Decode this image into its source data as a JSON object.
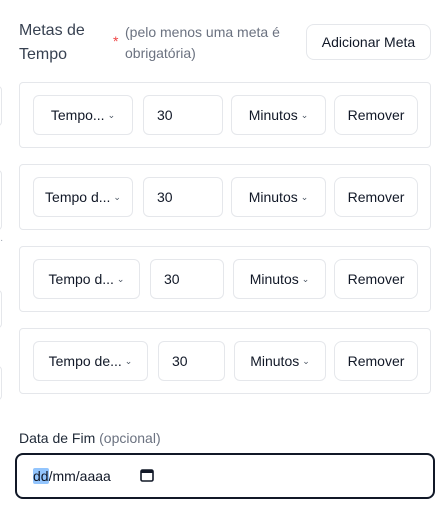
{
  "goals": {
    "title": "Metas de Tempo",
    "required_mark": "*",
    "hint": "(pelo menos uma meta é obrigatória)",
    "add_label": "Adicionar Meta",
    "items": [
      {
        "type_label": "Tempo...",
        "value": "30",
        "unit": "Minutos",
        "remove_label": "Remover"
      },
      {
        "type_label": "Tempo d...",
        "value": "30",
        "unit": "Minutos",
        "remove_label": "Remover"
      },
      {
        "type_label": "Tempo d...",
        "value": "30",
        "unit": "Minutos",
        "remove_label": "Remover"
      },
      {
        "type_label": "Tempo de...",
        "value": "30",
        "unit": "Minutos",
        "remove_label": "Remover"
      }
    ]
  },
  "end_date": {
    "label": "Data de Fim",
    "optional": "(opcional)",
    "placeholder_day": "dd",
    "placeholder_rest": "/mm/aaaa"
  },
  "icons": {
    "chevron": "chevron-down-icon",
    "calendar": "calendar-icon"
  },
  "colors": {
    "required": "#ef4444",
    "border": "#e5e7eb",
    "focus": "#111827",
    "selection": "#93c5fd"
  }
}
